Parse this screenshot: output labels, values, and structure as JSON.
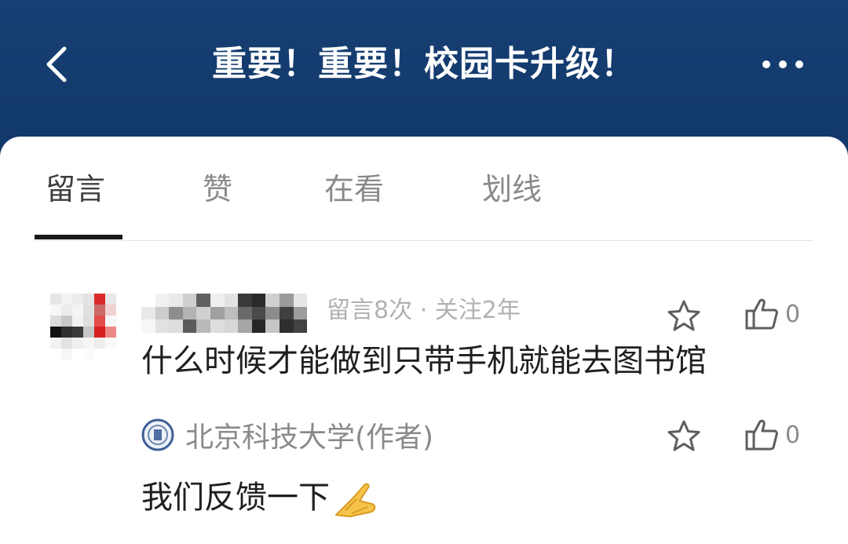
{
  "header": {
    "title": "重要！重要！校园卡升级！",
    "back_icon": "chevron-left-icon",
    "more_icon": "more-horizontal-icon",
    "background_color": "#143b6d"
  },
  "tabs": [
    {
      "label": "留言",
      "active": true
    },
    {
      "label": "赞",
      "active": false
    },
    {
      "label": "在看",
      "active": false
    },
    {
      "label": "划线",
      "active": false
    }
  ],
  "comments": [
    {
      "meta": "留言8次 · 关注2年",
      "text": "什么时候才能做到只带手机就能去图书馆",
      "like_count": "0"
    }
  ],
  "reply": {
    "author": "北京科技大学(作者)",
    "text": "我们反馈一下",
    "emoji_icon": "pray-hands-icon",
    "like_count": "0"
  },
  "colors": {
    "accent_text": "#1f1f1f",
    "muted_text": "#8a8a8a",
    "meta_text": "#b1b1b1"
  }
}
